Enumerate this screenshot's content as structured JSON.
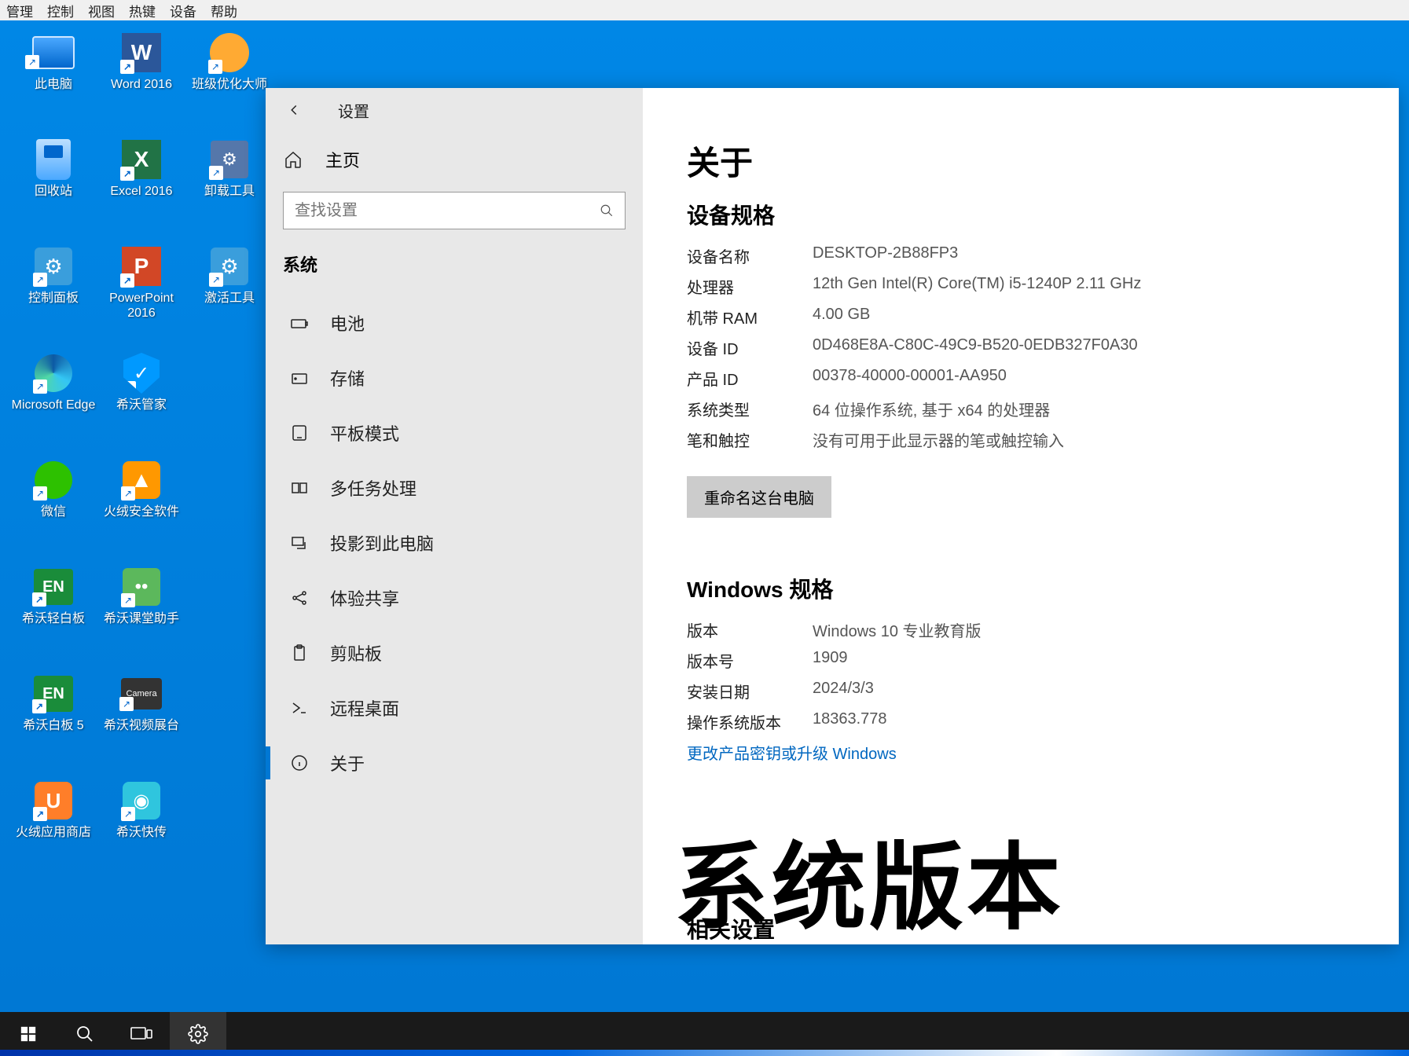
{
  "menu": [
    "管理",
    "控制",
    "视图",
    "热键",
    "设备",
    "帮助"
  ],
  "desktop_icons": [
    {
      "label": "此电脑",
      "icon": "monitor"
    },
    {
      "label": "Word 2016",
      "icon": "word"
    },
    {
      "label": "班级优化大师",
      "icon": "lion"
    },
    {
      "label": "回收站",
      "icon": "bin"
    },
    {
      "label": "Excel 2016",
      "icon": "excel"
    },
    {
      "label": "卸载工具",
      "icon": "tool"
    },
    {
      "label": "控制面板",
      "icon": "gear-blue"
    },
    {
      "label": "PowerPoint 2016",
      "icon": "ppt"
    },
    {
      "label": "激活工具",
      "icon": "gear-blue"
    },
    {
      "label": "Microsoft Edge",
      "icon": "edge"
    },
    {
      "label": "希沃管家",
      "icon": "shield"
    },
    {
      "label": "",
      "icon": ""
    },
    {
      "label": "微信",
      "icon": "wechat"
    },
    {
      "label": "火绒安全软件",
      "icon": "flame"
    },
    {
      "label": "",
      "icon": ""
    },
    {
      "label": "希沃轻白板",
      "icon": "en"
    },
    {
      "label": "希沃课堂助手",
      "icon": "green"
    },
    {
      "label": "",
      "icon": ""
    },
    {
      "label": "希沃白板 5",
      "icon": "en"
    },
    {
      "label": "希沃视频展台",
      "icon": "cam"
    },
    {
      "label": "",
      "icon": ""
    },
    {
      "label": "火绒应用商店",
      "icon": "orange"
    },
    {
      "label": "希沃快传",
      "icon": "cyan"
    }
  ],
  "settings": {
    "title": "设置",
    "home": "主页",
    "search_placeholder": "查找设置",
    "section": "系统",
    "nav": [
      {
        "id": "battery",
        "label": "电池",
        "icon": "battery"
      },
      {
        "id": "storage",
        "label": "存储",
        "icon": "storage"
      },
      {
        "id": "tablet",
        "label": "平板模式",
        "icon": "tablet"
      },
      {
        "id": "multitask",
        "label": "多任务处理",
        "icon": "multitask"
      },
      {
        "id": "project",
        "label": "投影到此电脑",
        "icon": "project"
      },
      {
        "id": "shared",
        "label": "体验共享",
        "icon": "shared"
      },
      {
        "id": "clipboard",
        "label": "剪贴板",
        "icon": "clipboard"
      },
      {
        "id": "remote",
        "label": "远程桌面",
        "icon": "remote"
      },
      {
        "id": "about",
        "label": "关于",
        "icon": "about",
        "active": true
      }
    ],
    "about": {
      "h1": "关于",
      "device_spec_h": "设备规格",
      "rows": [
        {
          "k": "设备名称",
          "v": "DESKTOP-2B88FP3"
        },
        {
          "k": "处理器",
          "v": "12th Gen Intel(R) Core(TM) i5-1240P   2.11 GHz"
        },
        {
          "k": "机带 RAM",
          "v": "4.00 GB"
        },
        {
          "k": "设备 ID",
          "v": "0D468E8A-C80C-49C9-B520-0EDB327F0A30"
        },
        {
          "k": "产品 ID",
          "v": "00378-40000-00001-AA950"
        },
        {
          "k": "系统类型",
          "v": "64 位操作系统, 基于 x64 的处理器"
        },
        {
          "k": "笔和触控",
          "v": "没有可用于此显示器的笔或触控输入"
        }
      ],
      "rename_btn": "重命名这台电脑",
      "win_spec_h": "Windows 规格",
      "win_rows": [
        {
          "k": "版本",
          "v": "Windows 10 专业教育版"
        },
        {
          "k": "版本号",
          "v": "1909"
        },
        {
          "k": "安装日期",
          "v": "2024/3/3"
        },
        {
          "k": "操作系统版本",
          "v": "18363.778"
        }
      ],
      "change_key_link": "更改产品密钥或升级 Windows",
      "related_h": "相关设置"
    }
  },
  "overlay_text": "系统版本"
}
